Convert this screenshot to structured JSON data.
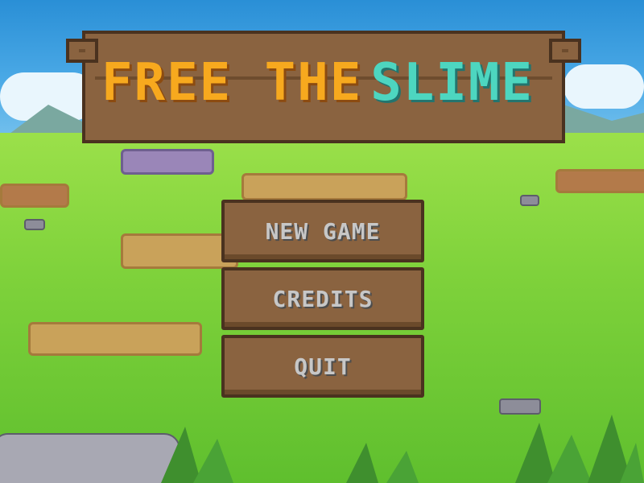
{
  "title": {
    "part1": "FREE THE",
    "part2": "SLIME"
  },
  "menu": {
    "new_game": "NEW GAME",
    "credits": "CREDITS",
    "quit": "QUIT"
  },
  "colors": {
    "title_orange": "#f7a91e",
    "slime_teal": "#4dd6c0",
    "wood": "#8a6340",
    "menu_text": "#c7c7c7"
  }
}
